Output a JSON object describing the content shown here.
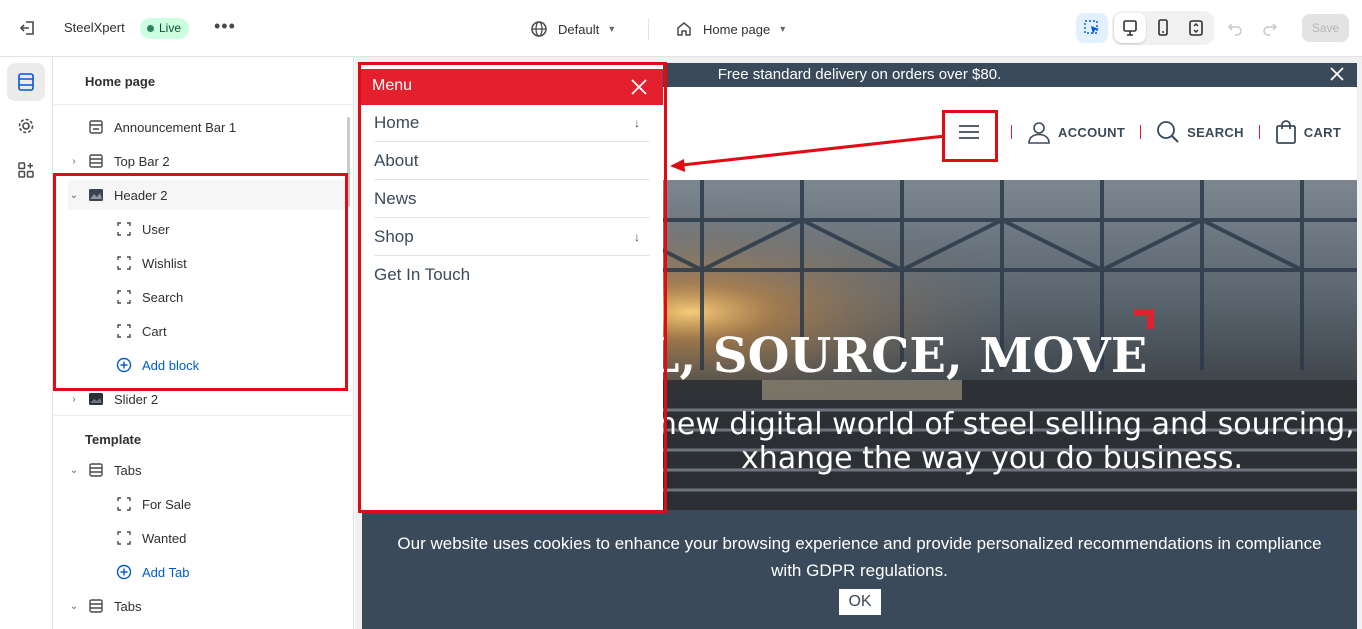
{
  "topbar": {
    "store_name": "SteelXpert",
    "status": "Live",
    "more": "•••",
    "theme": "Default",
    "page": "Home page",
    "save_label": "Save"
  },
  "sidebar": {
    "title": "Home page",
    "header_items": [
      {
        "label": "Announcement Bar 1"
      },
      {
        "label": "Top Bar 2"
      },
      {
        "label": "Header 2"
      },
      {
        "label": "User"
      },
      {
        "label": "Wishlist"
      },
      {
        "label": "Search"
      },
      {
        "label": "Cart"
      },
      {
        "label": "Add block"
      },
      {
        "label": "Slider 2"
      }
    ],
    "template_title": "Template",
    "template_items": [
      {
        "label": "Tabs"
      },
      {
        "label": "For Sale"
      },
      {
        "label": "Wanted"
      },
      {
        "label": "Add Tab"
      },
      {
        "label": "Tabs"
      }
    ]
  },
  "preview": {
    "announcement": "Free standard delivery on orders over $80.",
    "header_links": {
      "account": "ACCOUNT",
      "search": "SEARCH",
      "cart": "CART"
    },
    "hero": {
      "headline": "LL, SOURCE, MOVE",
      "sub_line1": "g new digital world of steel selling and sourcing,",
      "sub_line2": "xhange the way you do business."
    },
    "cookie": {
      "text": "Our website uses cookies to enhance your browsing experience and provide personalized recommendations in compliance with GDPR regulations.",
      "ok": "OK"
    }
  },
  "menu": {
    "title": "Menu",
    "items": [
      {
        "label": "Home",
        "sub": "↓"
      },
      {
        "label": "About"
      },
      {
        "label": "News"
      },
      {
        "label": "Shop",
        "sub": "↓"
      },
      {
        "label": "Get In Touch"
      }
    ]
  },
  "colors": {
    "accent_red": "#e5202e",
    "navy": "#3a4a5b",
    "annotation_red": "#e10b14",
    "live_green": "#29845a",
    "link_blue": "#005bd3"
  }
}
